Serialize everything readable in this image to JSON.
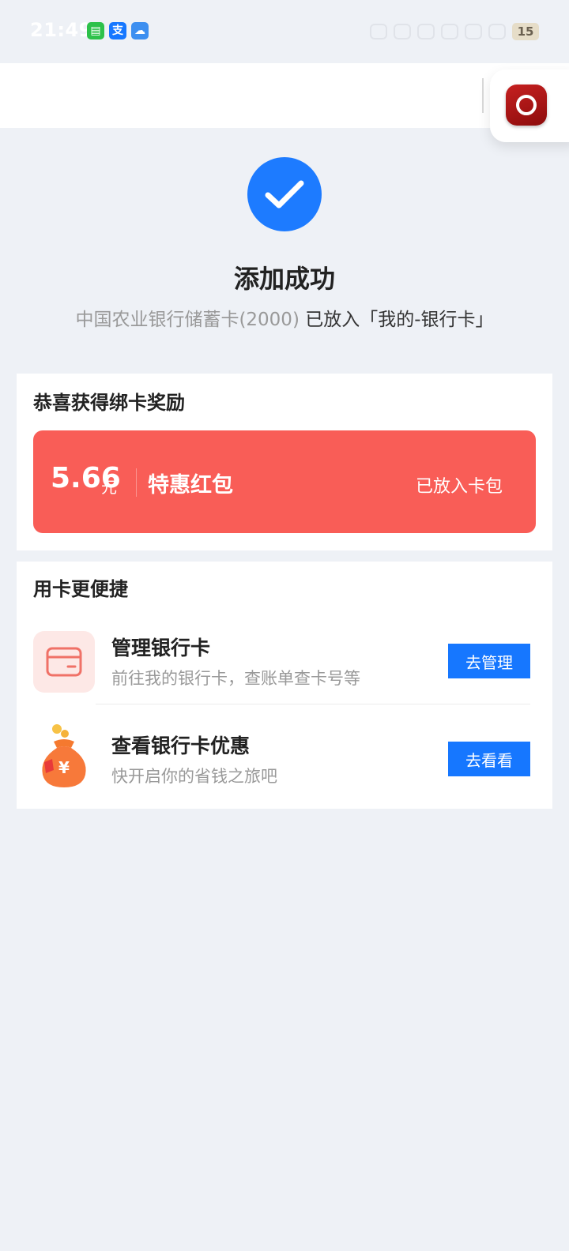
{
  "status_bar": {
    "time": "21:49",
    "apps": [
      {
        "icon": "message-icon",
        "color": "#2dc14a",
        "glyph": "▤"
      },
      {
        "icon": "alipay-icon",
        "color": "#1677ff",
        "glyph": "支"
      },
      {
        "icon": "weather-icon",
        "color": "#3d8ff0",
        "glyph": "☁"
      }
    ],
    "battery": "15"
  },
  "success": {
    "title": "添加成功",
    "desc_muted": "中国农业银行储蓄卡(2000)",
    "desc_rest": " 已放入「我的-银行卡」"
  },
  "reward": {
    "section_title": "恭喜获得绑卡奖励",
    "amount": "5.66",
    "unit": "元",
    "name": "特惠红包",
    "status": "已放入卡包",
    "color": "#f95d57"
  },
  "convenient": {
    "section_title": "用卡更便捷",
    "rows": [
      {
        "title": "管理银行卡",
        "subtitle": "前往我的银行卡，查账单查卡号等",
        "button": "去管理",
        "icon": "bank-card-icon"
      },
      {
        "title": "查看银行卡优惠",
        "subtitle": "快开启你的省钱之旅吧",
        "button": "去看看",
        "icon": "money-bag-icon"
      }
    ],
    "button_color": "#1677ff"
  }
}
